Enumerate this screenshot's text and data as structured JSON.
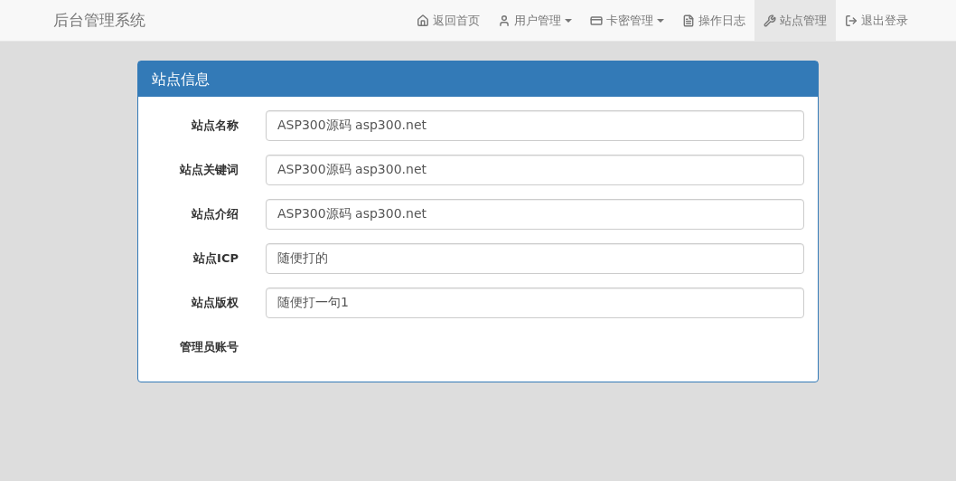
{
  "brand": "后台管理系统",
  "nav": [
    {
      "label": "返回首页",
      "dropdown": false,
      "selected": false
    },
    {
      "label": "用户管理",
      "dropdown": true,
      "selected": false
    },
    {
      "label": "卡密管理",
      "dropdown": true,
      "selected": false
    },
    {
      "label": "操作日志",
      "dropdown": false,
      "selected": false
    },
    {
      "label": "站点管理",
      "dropdown": false,
      "selected": true
    },
    {
      "label": "退出登录",
      "dropdown": false,
      "selected": false
    }
  ],
  "panel": {
    "title": "站点信息",
    "fields": [
      {
        "label": "站点名称",
        "kind": "input",
        "value": "ASP300源码 asp300.net"
      },
      {
        "label": "站点关键词",
        "kind": "input",
        "value": "ASP300源码 asp300.net"
      },
      {
        "label": "站点介绍",
        "kind": "input",
        "value": "ASP300源码 asp300.net"
      },
      {
        "label": "站点ICP",
        "kind": "input",
        "value": "随便打的"
      },
      {
        "label": "站点版权",
        "kind": "input",
        "value": "随便打一句1"
      },
      {
        "label": "管理员账号",
        "kind": "label"
      }
    ]
  }
}
